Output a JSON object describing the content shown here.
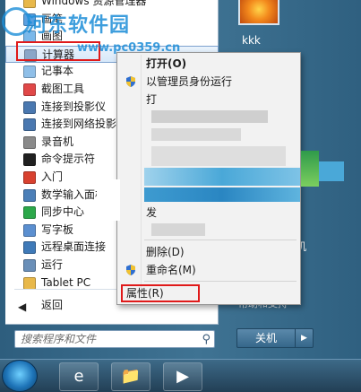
{
  "start_menu": {
    "programs": [
      {
        "label": "Windows 资源管理器",
        "icon": "folder-icon",
        "color": "#e8b84a"
      },
      {
        "label": "画笔",
        "icon": "paint-icon",
        "color": "#5aa0e0"
      },
      {
        "label": "画图",
        "icon": "paint-icon",
        "color": "#7ab8ea"
      },
      {
        "label": "计算器",
        "icon": "calculator-icon",
        "color": "#8aa6c8"
      },
      {
        "label": "记事本",
        "icon": "notepad-icon",
        "color": "#8fbfe8"
      },
      {
        "label": "截图工具",
        "icon": "scissors-icon",
        "color": "#e04848"
      },
      {
        "label": "连接到投影仪",
        "icon": "projector-icon",
        "color": "#4a78b0"
      },
      {
        "label": "连接到网络投影",
        "icon": "network-projector-icon",
        "color": "#4a78b0"
      },
      {
        "label": "录音机",
        "icon": "microphone-icon",
        "color": "#8a8a8a"
      },
      {
        "label": "命令提示符",
        "icon": "cmd-icon",
        "color": "#202020"
      },
      {
        "label": "入门",
        "icon": "getting-started-icon",
        "color": "#d8412f"
      },
      {
        "label": "数学输入面板",
        "icon": "math-input-icon",
        "color": "#4b7fb8"
      },
      {
        "label": "同步中心",
        "icon": "sync-icon",
        "color": "#2ca84a"
      },
      {
        "label": "写字板",
        "icon": "wordpad-icon",
        "color": "#5b8fd0"
      },
      {
        "label": "远程桌面连接",
        "icon": "remote-desktop-icon",
        "color": "#3f7ab8"
      },
      {
        "label": "运行",
        "icon": "run-icon",
        "color": "#6a8fb8"
      },
      {
        "label": "Tablet PC",
        "icon": "folder-icon",
        "color": "#e8b84a"
      }
    ],
    "back_label": "返回",
    "search_placeholder": "搜索程序和文件",
    "user_name": "kkk",
    "right_item_partial": "机",
    "help_text": "帮助和支持",
    "shutdown_label": "关机",
    "shutdown_arrow": "▶"
  },
  "context_menu": {
    "open": "打开(O)",
    "run_as_admin": "以管理员身份运行",
    "partial_pin": "打",
    "partial_send": "发",
    "delete": "删除(D)",
    "rename": "重命名(M)",
    "properties": "属性(R)"
  },
  "watermark": {
    "title": "河东软件园",
    "url": "www.pc0359.cn"
  },
  "taskbar": {
    "icons": [
      "start-orb",
      "ie-icon",
      "explorer-icon",
      "media-player-icon"
    ]
  },
  "colors": {
    "highlight_outline": "#e01a1a",
    "watermark": "#1d8ed8"
  }
}
